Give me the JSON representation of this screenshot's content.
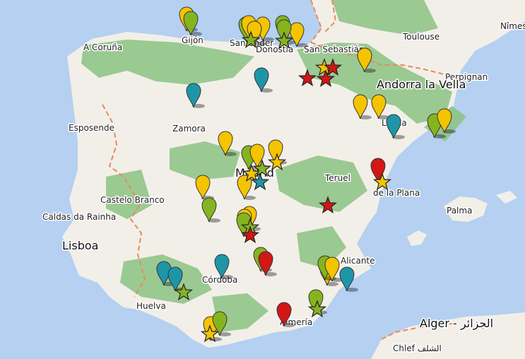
{
  "colors": {
    "sea": "#b5d0f0",
    "land": "#f2efe9",
    "forest": "#8cc282",
    "border": "#e98a57",
    "marker_yellow": "#f5c400",
    "marker_green": "#86b41f",
    "marker_teal": "#1f95a8",
    "marker_red": "#d31616"
  },
  "labels": [
    {
      "text": "A Coruña",
      "size": "normal"
    },
    {
      "text": "Gijón",
      "size": "normal"
    },
    {
      "text": "Santander",
      "size": "normal"
    },
    {
      "text": "Donostia",
      "size": "normal"
    },
    {
      "text": "San Sebastián",
      "size": "normal"
    },
    {
      "text": "Toulouse",
      "size": "normal"
    },
    {
      "text": "Nîmes",
      "size": "normal"
    },
    {
      "text": "Perpignan",
      "size": "normal"
    },
    {
      "text": "Andorra la Vella",
      "size": "big"
    },
    {
      "text": "Esposende",
      "size": "normal"
    },
    {
      "text": "Zamora",
      "size": "normal"
    },
    {
      "text": "Lleida",
      "size": "normal"
    },
    {
      "text": "Madrid",
      "size": "big"
    },
    {
      "text": "Teruel",
      "size": "normal"
    },
    {
      "text": "de la Plana",
      "size": "normal"
    },
    {
      "text": "Castelo Branco",
      "size": "normal"
    },
    {
      "text": "Caldas da Rainha",
      "size": "normal"
    },
    {
      "text": "Palma",
      "size": "normal"
    },
    {
      "text": "Lisboa",
      "size": "big"
    },
    {
      "text": "Alicante",
      "size": "normal"
    },
    {
      "text": "Córdoba",
      "size": "normal"
    },
    {
      "text": "Huelva",
      "size": "normal"
    },
    {
      "text": "Almería",
      "size": "normal"
    },
    {
      "text": "Alger - الجزائر",
      "size": "big"
    },
    {
      "text": "Chlef الشلف",
      "size": "normal"
    }
  ],
  "markers": [
    {
      "type": "pin",
      "color": "yellow"
    },
    {
      "type": "pin",
      "color": "green"
    },
    {
      "type": "pin",
      "color": "green"
    },
    {
      "type": "pin",
      "color": "yellow"
    },
    {
      "type": "pin",
      "color": "yellow"
    },
    {
      "type": "pin",
      "color": "green"
    },
    {
      "type": "pin",
      "color": "yellow"
    },
    {
      "type": "pin",
      "color": "green"
    },
    {
      "type": "pin",
      "color": "yellow"
    },
    {
      "type": "star",
      "color": "green"
    },
    {
      "type": "star",
      "color": "green"
    },
    {
      "type": "star",
      "color": "yellow"
    },
    {
      "type": "star",
      "color": "red"
    },
    {
      "type": "star",
      "color": "red"
    },
    {
      "type": "star",
      "color": "red"
    },
    {
      "type": "pin",
      "color": "yellow"
    },
    {
      "type": "pin",
      "color": "teal"
    },
    {
      "type": "pin",
      "color": "teal"
    },
    {
      "type": "pin",
      "color": "yellow"
    },
    {
      "type": "pin",
      "color": "yellow"
    },
    {
      "type": "pin",
      "color": "teal"
    },
    {
      "type": "pin",
      "color": "green"
    },
    {
      "type": "pin",
      "color": "yellow"
    },
    {
      "type": "pin",
      "color": "yellow"
    },
    {
      "type": "pin",
      "color": "green"
    },
    {
      "type": "pin",
      "color": "yellow"
    },
    {
      "type": "pin",
      "color": "yellow"
    },
    {
      "type": "pin",
      "color": "yellow"
    },
    {
      "type": "star",
      "color": "yellow"
    },
    {
      "type": "star",
      "color": "yellow"
    },
    {
      "type": "star",
      "color": "green"
    },
    {
      "type": "star",
      "color": "teal"
    },
    {
      "type": "pin",
      "color": "red"
    },
    {
      "type": "star",
      "color": "yellow"
    },
    {
      "type": "pin",
      "color": "yellow"
    },
    {
      "type": "pin",
      "color": "yellow"
    },
    {
      "type": "pin",
      "color": "green"
    },
    {
      "type": "star",
      "color": "red"
    },
    {
      "type": "pin",
      "color": "yellow"
    },
    {
      "type": "pin",
      "color": "green"
    },
    {
      "type": "star",
      "color": "green"
    },
    {
      "type": "star",
      "color": "red"
    },
    {
      "type": "pin",
      "color": "green"
    },
    {
      "type": "pin",
      "color": "red"
    },
    {
      "type": "pin",
      "color": "teal"
    },
    {
      "type": "pin",
      "color": "teal"
    },
    {
      "type": "pin",
      "color": "teal"
    },
    {
      "type": "star",
      "color": "green"
    },
    {
      "type": "pin",
      "color": "yellow"
    },
    {
      "type": "pin",
      "color": "green"
    },
    {
      "type": "pin",
      "color": "yellow"
    },
    {
      "type": "pin",
      "color": "teal"
    },
    {
      "type": "pin",
      "color": "green"
    },
    {
      "type": "star",
      "color": "green"
    },
    {
      "type": "pin",
      "color": "red"
    },
    {
      "type": "pin",
      "color": "yellow"
    },
    {
      "type": "pin",
      "color": "green"
    },
    {
      "type": "star",
      "color": "yellow"
    }
  ]
}
